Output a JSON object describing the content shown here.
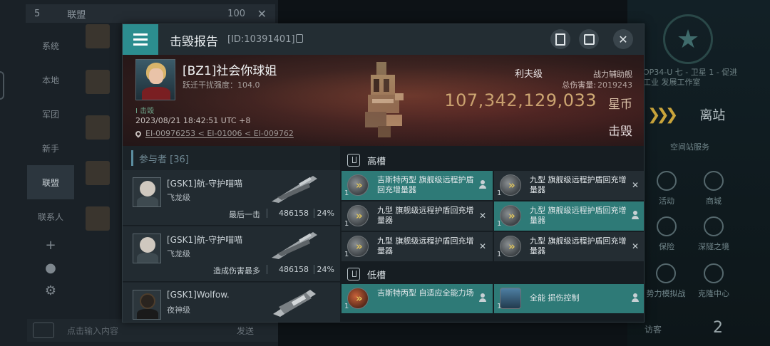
{
  "chat": {
    "online_count": "5",
    "title": "联盟",
    "member_count": "100",
    "close_icon": "✕",
    "sidebar": [
      "系统",
      "本地",
      "军团",
      "新手",
      "联盟",
      "联系人"
    ],
    "input_placeholder": "点击输入内容",
    "send_label": "发送"
  },
  "station": {
    "info_line1": "OP34-U 七 - 卫星 1 - 促进",
    "info_line2": "工业 发展工作室",
    "undock_label": "离站",
    "services_label": "空间站服务",
    "icons": [
      "活动",
      "商城",
      "保险",
      "深隧之境",
      "势力模拟战",
      "克隆中心"
    ],
    "visitors_label": "访客",
    "visitors_count": "2"
  },
  "modal": {
    "title": "击毁报告",
    "report_id": "[ID:10391401]",
    "close_icon": "✕"
  },
  "victim": {
    "name": "[BZ1]社会你球姐",
    "warp_strength": "跃迁干扰强度：104.0",
    "final_blow_tag": "I 击毁",
    "time": "2023/08/21 18:42:51 UTC +8",
    "location": "EI-00976253 < EI-01006 < EI-009762",
    "ship_class": "利夫级",
    "ship_role": "战力辅助舰",
    "total_damage_label": "总伤害量:",
    "total_damage": "2019243",
    "isk_value": "107,342,129,033",
    "isk_unit": "星币",
    "status": "击毁"
  },
  "participants": {
    "header": "参与者 [36]",
    "rows": [
      {
        "name": "[GSK1]航-守护喵喵",
        "ship": "飞龙级",
        "note": "最后一击",
        "damage": "486158",
        "percent": "24%"
      },
      {
        "name": "[GSK1]航-守护喵喵",
        "ship": "飞龙级",
        "note": "造成伤害最多",
        "damage": "486158",
        "percent": "24%"
      },
      {
        "name": "[GSK1]Wolfow.",
        "ship": "夜神级",
        "note": "",
        "damage": "",
        "percent": ""
      }
    ]
  },
  "fittings": {
    "high_slot_label": "高槽",
    "low_slot_label": "低槽",
    "high_modules": [
      {
        "name": "吉斯特丙型 旗舰级远程护盾回充增量器",
        "qty": "1",
        "highlight": true,
        "status": "person"
      },
      {
        "name": "九型 旗舰级远程护盾回充增量器",
        "qty": "1",
        "highlight": false,
        "status": "x"
      },
      {
        "name": "九型 旗舰级远程护盾回充增量器",
        "qty": "1",
        "highlight": false,
        "status": "x"
      },
      {
        "name": "九型 旗舰级远程护盾回充增量器",
        "qty": "1",
        "highlight": true,
        "status": "person"
      },
      {
        "name": "九型 旗舰级远程护盾回充增量器",
        "qty": "1",
        "highlight": false,
        "status": "x"
      },
      {
        "name": "九型 旗舰级远程护盾回充增量器",
        "qty": "1",
        "highlight": false,
        "status": "x"
      }
    ],
    "low_modules": [
      {
        "name": "吉斯特丙型 自适应全能力场",
        "qty": "1",
        "highlight": true,
        "status": "person"
      },
      {
        "name": "全能 损伤控制",
        "qty": "1",
        "highlight": true,
        "status": "person"
      }
    ]
  },
  "colors": {
    "accent_teal": "#2c8d8f",
    "isk_gold": "#e8cf8a",
    "module_highlight": "#2e7a77"
  }
}
